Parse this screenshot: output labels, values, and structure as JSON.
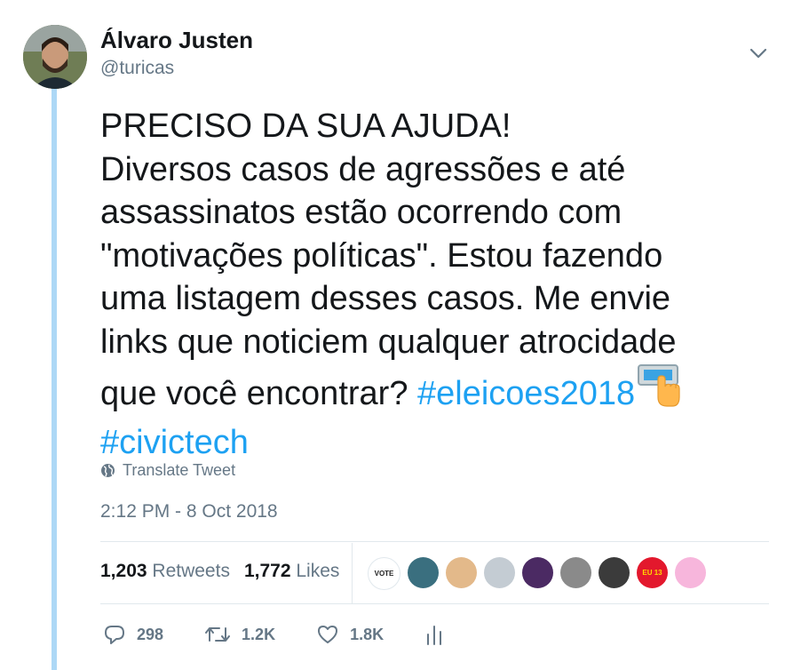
{
  "author": {
    "display_name": "Álvaro Justen",
    "handle": "@turicas"
  },
  "tweet": {
    "lines": [
      "PRECISO DA SUA AJUDA!",
      "Diversos casos de agressões e até",
      "assassinatos estão ocorrendo com",
      "\"motivações políticas\". Estou fazendo",
      "uma listagem desses casos. Me envie",
      "links que noticiem qualquer atrocidade",
      "que você encontrar? "
    ],
    "hashtag_1": "#eleicoes2018",
    "emoji": "ballot-box-with-pointing-hand-emoji",
    "hashtag_2": "#civictech",
    "translate_label": "Translate Tweet",
    "timestamp": "2:12 PM - 8 Oct 2018"
  },
  "engagement": {
    "retweets_count": "1,203",
    "retweets_label": "Retweets",
    "likes_count": "1,772",
    "likes_label": "Likes",
    "liker_avatars": [
      {
        "icon": "vote-cartoon-avatar",
        "text": "VOTE",
        "bg": "#ffffff",
        "fg": "#222222"
      },
      {
        "icon": "man-beard-avatar",
        "text": "",
        "bg": "#3a6f7f",
        "fg": "#ffffff"
      },
      {
        "icon": "woman-blonde-avatar",
        "text": "",
        "bg": "#e3b98a",
        "fg": "#ffffff"
      },
      {
        "icon": "default-egg-avatar",
        "text": "",
        "bg": "#c4ccd3",
        "fg": "#ffffff"
      },
      {
        "icon": "cartoon-glasses-avatar",
        "text": "",
        "bg": "#4b2a63",
        "fg": "#ffffff"
      },
      {
        "icon": "man-photo-avatar",
        "text": "",
        "bg": "#8a8a8a",
        "fg": "#ffffff"
      },
      {
        "icon": "woman-photo-avatar",
        "text": "",
        "bg": "#3b3b3b",
        "fg": "#ffffff"
      },
      {
        "icon": "eu-voto-13-avatar",
        "text": "EU 13",
        "bg": "#e3182d",
        "fg": "#ffd800"
      },
      {
        "icon": "pink-logo-avatar",
        "text": "",
        "bg": "#f7b6dc",
        "fg": "#c2186b"
      }
    ]
  },
  "actions": {
    "reply_count": "298",
    "retweet_count": "1.2K",
    "like_count": "1.8K"
  },
  "colors": {
    "accent": "#1da1f2",
    "secondary_text": "#657786",
    "thread_line": "#add8f6",
    "divider": "#e1e8ed"
  }
}
